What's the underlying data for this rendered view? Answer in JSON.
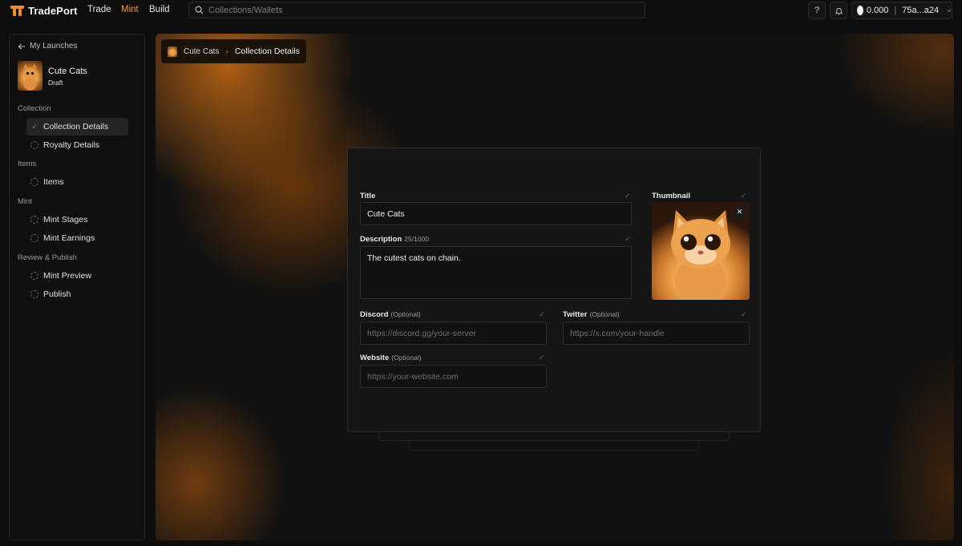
{
  "header": {
    "brand": "TradePort",
    "nav": [
      {
        "label": "Trade"
      },
      {
        "label": "Mint"
      },
      {
        "label": "Build"
      }
    ],
    "search": {
      "placeholder": "Collections/Wallets"
    },
    "help_label": "?",
    "wallet": {
      "balance": "0.000",
      "address": "75a...a24"
    }
  },
  "sidebar": {
    "back_label": "My Launches",
    "collection": {
      "name": "Cute Cats",
      "status": "Draft"
    },
    "sections": [
      {
        "title": "Collection",
        "items": [
          {
            "label": "Collection Details"
          },
          {
            "label": "Royalty Details"
          }
        ]
      },
      {
        "title": "Items",
        "items": [
          {
            "label": "Items"
          }
        ]
      },
      {
        "title": "Mint",
        "items": [
          {
            "label": "Mint Stages"
          },
          {
            "label": "Mint Earnings"
          }
        ]
      },
      {
        "title": "Review & Publish",
        "items": [
          {
            "label": "Mint Preview"
          },
          {
            "label": "Publish"
          }
        ]
      }
    ]
  },
  "breadcrumb": {
    "parent": "Cute Cats",
    "current": "Collection Details"
  },
  "form": {
    "title": {
      "label": "Title",
      "value": "Cute Cats"
    },
    "description": {
      "label": "Description",
      "counter": "25/1000",
      "value": "The cutest cats on chain."
    },
    "thumbnail": {
      "label": "Thumbnail",
      "remove": "✕"
    },
    "discord": {
      "label": "Discord",
      "optional": "(Optional)",
      "placeholder": "https://discord.gg/your-server"
    },
    "twitter": {
      "label": "Twitter",
      "optional": "(Optional)",
      "placeholder": "https://x.com/your-handle"
    },
    "website": {
      "label": "Website",
      "optional": "(Optional)",
      "placeholder": "https://your-website.com"
    }
  },
  "colors": {
    "accent": "#f29a3a",
    "background": "#0d0d0d"
  }
}
